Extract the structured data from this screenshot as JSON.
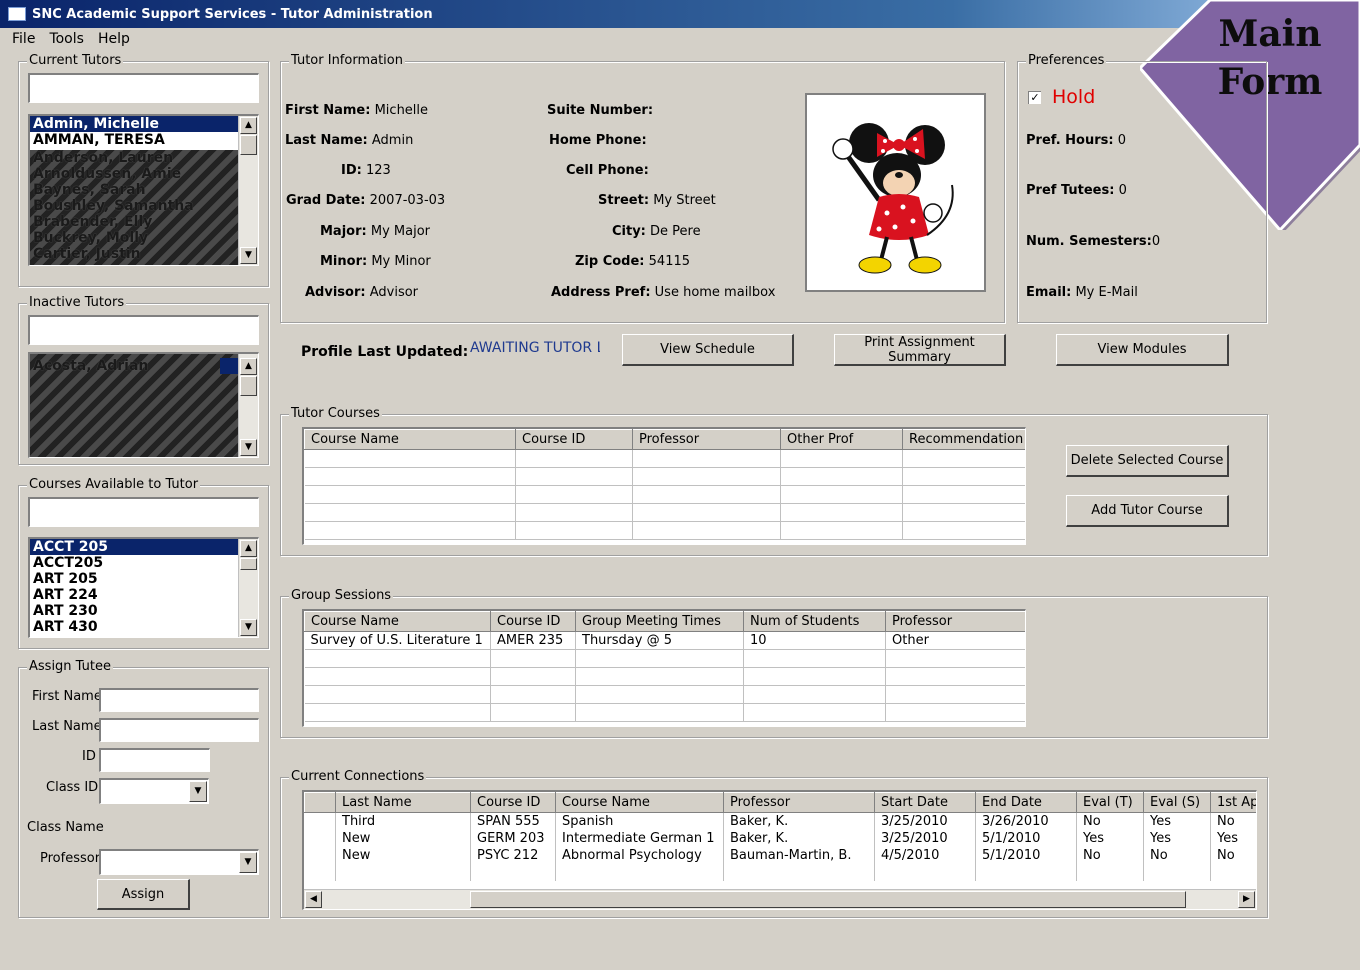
{
  "window": {
    "title": "SNC Academic Support Services - Tutor Administration"
  },
  "menu": [
    "File",
    "Tools",
    "Help"
  ],
  "banner": {
    "line1": "Main",
    "line2": "Form"
  },
  "current_tutors": {
    "label": "Current Tutors",
    "search_value": "",
    "items": [
      "Admin, Michelle",
      "AMMAN, TERESA",
      "Anderson, Lauren",
      "Arnoldussen, Amie",
      "Baynes, Sarah",
      "Boushley, Samantha",
      "Brabender, Elly",
      "Buckrey, Molly",
      "Cartier, Justin"
    ]
  },
  "inactive_tutors": {
    "label": "Inactive Tutors",
    "search_value": "",
    "items": [
      "Acosta, Adrian"
    ]
  },
  "courses_available": {
    "label": "Courses Available to Tutor",
    "search_value": "",
    "items": [
      "ACCT 205",
      "ACCT205",
      "ART 205",
      "ART 224",
      "ART 230",
      "ART 430"
    ]
  },
  "assign_tutee": {
    "label": "Assign Tutee",
    "first_name_label": "First Name",
    "last_name_label": "Last Name",
    "id_label": "ID",
    "class_id_label": "Class ID",
    "class_name_label": "Class Name",
    "professor_label": "Professor",
    "assign_button": "Assign"
  },
  "tutor_info": {
    "label": "Tutor Information",
    "first_name": {
      "label": "First Name:",
      "value": "Michelle"
    },
    "last_name": {
      "label": "Last Name:",
      "value": "Admin"
    },
    "id": {
      "label": "ID:",
      "value": "123"
    },
    "grad_date": {
      "label": "Grad Date:",
      "value": "2007-03-03"
    },
    "major": {
      "label": "Major:",
      "value": "My Major"
    },
    "minor": {
      "label": "Minor:",
      "value": "My Minor"
    },
    "advisor": {
      "label": "Advisor:",
      "value": "Advisor"
    },
    "suite_number": {
      "label": "Suite Number:",
      "value": ""
    },
    "home_phone": {
      "label": "Home Phone:",
      "value": ""
    },
    "cell_phone": {
      "label": "Cell Phone:",
      "value": ""
    },
    "street": {
      "label": "Street:",
      "value": "My Street"
    },
    "city": {
      "label": "City:",
      "value": "De Pere"
    },
    "zip_code": {
      "label": "Zip Code:",
      "value": "54115"
    },
    "address_pref": {
      "label": "Address Pref:",
      "value": "Use home mailbox"
    }
  },
  "preferences": {
    "label": "Preferences",
    "hold_label": "Hold",
    "hold_checked": true,
    "pref_hours": {
      "label": "Pref. Hours:",
      "value": "0"
    },
    "pref_tutees": {
      "label": "Pref Tutees:",
      "value": "0"
    },
    "num_semesters": {
      "label": "Num. Semesters:",
      "value": "0"
    },
    "email": {
      "label": "Email:",
      "value": "My E-Mail"
    }
  },
  "profile": {
    "label": "Profile Last Updated:",
    "value": "AWAITING TUTOR L",
    "view_schedule": "View Schedule",
    "print_summary": "Print Assignment Summary",
    "view_modules": "View Modules"
  },
  "tutor_courses": {
    "label": "Tutor Courses",
    "columns": [
      "Course Name",
      "Course ID",
      "Professor",
      "Other Prof",
      "Recommendation"
    ],
    "delete_button": "Delete Selected Course",
    "add_button": "Add Tutor Course"
  },
  "group_sessions": {
    "label": "Group Sessions",
    "columns": [
      "Course Name",
      "Course ID",
      "Group Meeting Times",
      "Num of Students",
      "Professor"
    ],
    "rows": [
      [
        "Survey of U.S. Literature 1",
        "AMER 235",
        "Thursday  @ 5",
        "10",
        "Other"
      ]
    ]
  },
  "current_connections": {
    "label": "Current Connections",
    "columns": [
      "",
      "Last Name",
      "Course ID",
      "Course Name",
      "Professor",
      "Start Date",
      "End Date",
      "Eval (T)",
      "Eval (S)",
      "1st Ap"
    ],
    "rows": [
      [
        "",
        "Third",
        "SPAN 555",
        "Spanish",
        "Baker, K.",
        "3/25/2010",
        "3/26/2010",
        "No",
        "Yes",
        "No"
      ],
      [
        "",
        "New",
        "GERM 203",
        "Intermediate German 1",
        "Baker, K.",
        "3/25/2010",
        "5/1/2010",
        "Yes",
        "Yes",
        "Yes"
      ],
      [
        "",
        "New",
        "PSYC 212",
        "Abnormal Psychology",
        "Bauman-Martin, B.",
        "4/5/2010",
        "5/1/2010",
        "No",
        "No",
        "No"
      ]
    ]
  },
  "colors": {
    "titlebar": "#0a246a",
    "selection": "#0a246a",
    "hold": "#e00000",
    "banner_fill": "#8064a2",
    "link_value": "#1f3a8f"
  }
}
